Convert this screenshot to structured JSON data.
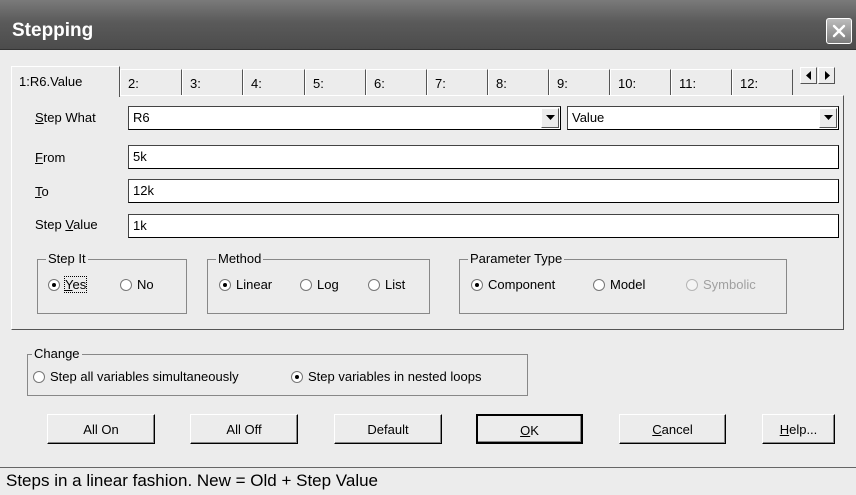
{
  "window": {
    "title": "Stepping"
  },
  "tabs": [
    {
      "label": "1:R6.Value",
      "active": true
    },
    {
      "label": "2:"
    },
    {
      "label": "3:"
    },
    {
      "label": "4:"
    },
    {
      "label": "5:"
    },
    {
      "label": "6:"
    },
    {
      "label": "7:"
    },
    {
      "label": "8:"
    },
    {
      "label": "9:"
    },
    {
      "label": "10:"
    },
    {
      "label": "11:"
    },
    {
      "label": "12:"
    }
  ],
  "form": {
    "step_what_label_u": "S",
    "step_what_label_rest": "tep What",
    "step_what_value": "R6",
    "property_value": "Value",
    "from_label_u": "F",
    "from_label_rest": "rom",
    "from_value": "5k",
    "to_label_u": "T",
    "to_label_rest": "o",
    "to_value": "12k",
    "step_value_label_pre": "Step ",
    "step_value_label_u": "V",
    "step_value_label_rest": "alue",
    "step_value_value": "1k"
  },
  "step_it": {
    "title": "Step It",
    "yes_u": "Y",
    "yes_rest": "es",
    "no": "No",
    "selected": "Yes"
  },
  "method": {
    "title": "Method",
    "linear": "Linear",
    "log": "Log",
    "list": "List",
    "selected": "Linear"
  },
  "parameter_type": {
    "title": "Parameter Type",
    "component": "Component",
    "model": "Model",
    "symbolic": "Symbolic",
    "selected": "Component"
  },
  "change": {
    "title": "Change",
    "all": "Step all variables simultaneously",
    "nested": "Step variables in nested loops",
    "selected": "nested"
  },
  "buttons": {
    "all_on": "All On",
    "all_off": "All Off",
    "default": "Default",
    "ok_u": "O",
    "ok_rest": "K",
    "cancel_u": "C",
    "cancel_rest": "ancel",
    "help_u": "H",
    "help_rest": "elp..."
  },
  "status": "Steps in a linear fashion. New = Old + Step Value",
  "colors": {
    "titlebar": "#5a5a5a",
    "dialog_bg": "#ececec",
    "disabled_text": "#a0a0a0"
  }
}
